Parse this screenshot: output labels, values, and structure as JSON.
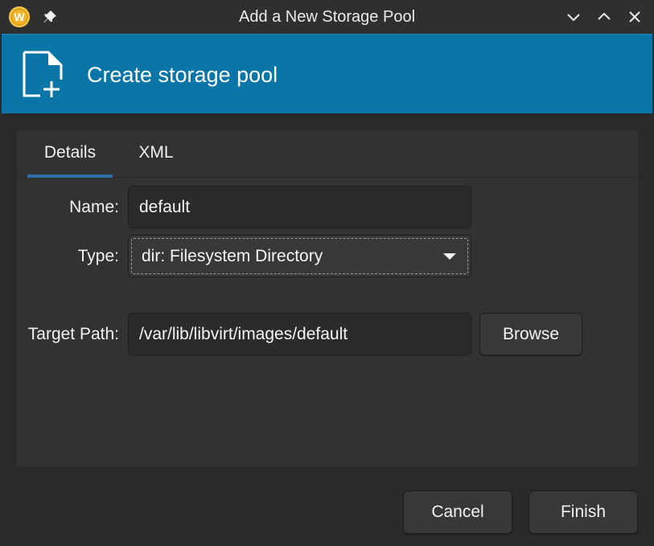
{
  "window": {
    "title": "Add a New Storage Pool",
    "app_icon_letter": "W",
    "controls": [
      "minimize",
      "maximize",
      "close"
    ]
  },
  "banner": {
    "title": "Create storage pool",
    "icon": "new-document-icon",
    "color": "#0a76a8"
  },
  "tabs": [
    {
      "label": "Details",
      "active": true
    },
    {
      "label": "XML",
      "active": false
    }
  ],
  "form": {
    "name_label": "Name:",
    "name_value": "default",
    "type_label": "Type:",
    "type_value": "dir: Filesystem Directory",
    "target_label": "Target Path:",
    "target_value": "/var/lib/libvirt/images/default",
    "browse_label": "Browse"
  },
  "footer": {
    "cancel_label": "Cancel",
    "finish_label": "Finish"
  },
  "colors": {
    "accent": "#2f6fa8",
    "background": "#2a2a2a",
    "panel": "#323232"
  }
}
